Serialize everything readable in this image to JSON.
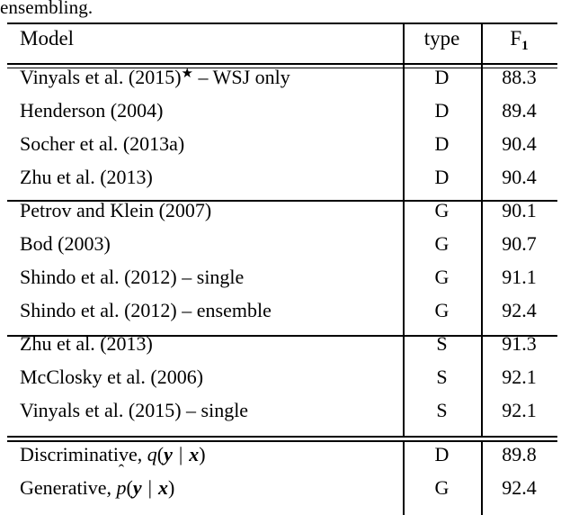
{
  "page": {
    "caption_fragment": "ensembling."
  },
  "table": {
    "name": "parsing-results",
    "columns": [
      {
        "key": "model",
        "label": "Model",
        "align": "left"
      },
      {
        "key": "type",
        "label": "type",
        "align": "center"
      },
      {
        "key": "f1",
        "label": "F1",
        "label_base": "F",
        "label_sub": "1",
        "align": "center"
      }
    ],
    "groups": [
      {
        "id": "discriminative-group",
        "rows": [
          {
            "model_prefix": "Vinyals et al. (2015)",
            "model_star": "★",
            "model_suffix": " – WSJ only",
            "model": "Vinyals et al. (2015)★ – WSJ only",
            "type": "D",
            "f1": "88.3"
          },
          {
            "model": "Henderson (2004)",
            "type": "D",
            "f1": "89.4"
          },
          {
            "model": "Socher et al. (2013a)",
            "type": "D",
            "f1": "90.4"
          },
          {
            "model": "Zhu et al. (2013)",
            "type": "D",
            "f1": "90.4"
          }
        ]
      },
      {
        "id": "generative-group",
        "rows": [
          {
            "model": "Petrov and Klein (2007)",
            "type": "G",
            "f1": "90.1"
          },
          {
            "model": "Bod (2003)",
            "type": "G",
            "f1": "90.7"
          },
          {
            "model": "Shindo et al. (2012) – single",
            "type": "G",
            "f1": "91.1"
          },
          {
            "model": "Shindo et al. (2012) – ensemble",
            "type": "G",
            "f1": "92.4"
          }
        ]
      },
      {
        "id": "semisupervised-group",
        "rows": [
          {
            "model": "Zhu et al. (2013)",
            "type": "S",
            "f1": "91.3"
          },
          {
            "model": "McClosky et al. (2006)",
            "type": "S",
            "f1": "92.1"
          },
          {
            "model": "Vinyals et al. (2015) – single",
            "type": "S",
            "f1": "92.1"
          }
        ]
      },
      {
        "id": "this-work-group",
        "rows": [
          {
            "model": "Discriminative, q(y | x)",
            "model_label": "Discriminative,",
            "math_fn": "q",
            "math_hat": "",
            "math_arg1": "y",
            "math_bar": "|",
            "math_arg2": "x",
            "type": "D",
            "f1": "89.8"
          },
          {
            "model": "Generative, p̂(y | x)",
            "model_label": "Generative,",
            "math_fn": "p",
            "math_hat": "ˆ",
            "math_arg1": "y",
            "math_bar": "|",
            "math_arg2": "x",
            "type": "G",
            "f1": "92.4"
          }
        ]
      }
    ]
  },
  "style": {
    "rule_color": "#000000",
    "text_color": "#000000",
    "background": "#ffffff"
  }
}
